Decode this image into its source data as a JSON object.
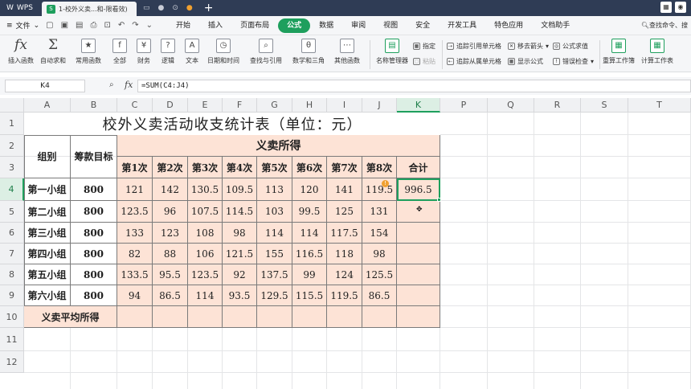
{
  "app": {
    "name": "WPS",
    "doc_tab": "1-校外义卖...和-限看效)",
    "doc_icon": "S"
  },
  "menu": {
    "file_label": "文件",
    "tabs": [
      "开始",
      "插入",
      "页面布局",
      "公式",
      "数据",
      "审阅",
      "视图",
      "安全",
      "开发工具",
      "特色应用",
      "文档助手"
    ],
    "active_tab": "公式",
    "search_label": "查找命令、搜"
  },
  "ribbon": {
    "insert_function": "插入函数",
    "autosum": "自动求和",
    "common": "常用函数",
    "all": "全部",
    "financial": "财务",
    "logical": "逻辑",
    "text": "文本",
    "datetime": "日期和时间",
    "lookup": "查找与引用",
    "math": "数学和三角",
    "other": "其他函数",
    "name_manager": "名称管理器",
    "specify": "指定",
    "paste": "粘贴",
    "trace_precedents": "追踪引用单元格",
    "trace_dependents": "追踪从属单元格",
    "remove_arrows": "移去箭头",
    "show_formulas": "显示公式",
    "evaluate": "公式求值",
    "error_check": "错误检查",
    "recalc_workbook": "重算工作簿",
    "calc_sheet": "计算工作表"
  },
  "formula_bar": {
    "cell_ref": "K4",
    "fx": "fx",
    "formula": "=SUM(C4:J4)"
  },
  "columns": [
    "A",
    "B",
    "C",
    "D",
    "E",
    "F",
    "G",
    "H",
    "I",
    "J",
    "K",
    "P",
    "Q",
    "R",
    "S",
    "T"
  ],
  "selected_column": "K",
  "rows": [
    "1",
    "2",
    "3",
    "4",
    "5",
    "6",
    "7",
    "8",
    "9",
    "10",
    "11",
    "12"
  ],
  "selected_row": "4",
  "sheet": {
    "title": "校外义卖活动收支统计表（单位：元）",
    "header_group": "组别",
    "header_target": "筹款目标",
    "header_income": "义卖所得",
    "header_times": [
      "第1次",
      "第2次",
      "第3次",
      "第4次",
      "第5次",
      "第6次",
      "第7次",
      "第8次"
    ],
    "header_total": "合计",
    "groups": [
      {
        "name": "第一小组",
        "target": "800",
        "values": [
          "121",
          "142",
          "130.5",
          "109.5",
          "113",
          "120",
          "141",
          "119.5"
        ],
        "total": "996.5"
      },
      {
        "name": "第二小组",
        "target": "800",
        "values": [
          "123.5",
          "96",
          "107.5",
          "114.5",
          "103",
          "99.5",
          "125",
          "131"
        ],
        "total": ""
      },
      {
        "name": "第三小组",
        "target": "800",
        "values": [
          "133",
          "123",
          "108",
          "98",
          "114",
          "114",
          "117.5",
          "154"
        ],
        "total": ""
      },
      {
        "name": "第四小组",
        "target": "800",
        "values": [
          "82",
          "88",
          "106",
          "121.5",
          "155",
          "116.5",
          "118",
          "98"
        ],
        "total": ""
      },
      {
        "name": "第五小组",
        "target": "800",
        "values": [
          "133.5",
          "95.5",
          "123.5",
          "92",
          "137.5",
          "99",
          "124",
          "125.5"
        ],
        "total": ""
      },
      {
        "name": "第六小组",
        "target": "800",
        "values": [
          "94",
          "86.5",
          "114",
          "93.5",
          "129.5",
          "115.5",
          "119.5",
          "86.5"
        ],
        "total": ""
      }
    ],
    "avg_label": "义卖平均所得"
  }
}
